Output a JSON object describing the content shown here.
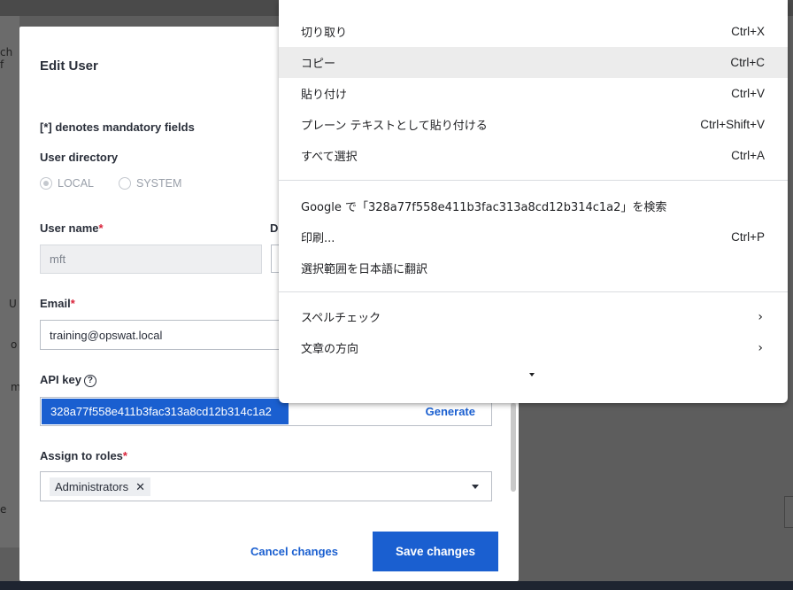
{
  "background": {
    "fragments": [
      "ch f",
      "U",
      "o",
      "m",
      "e"
    ]
  },
  "modal": {
    "title": "Edit User",
    "mandatory_note": "[*] denotes mandatory fields",
    "user_directory": {
      "label": "User directory",
      "options": [
        "LOCAL",
        "SYSTEM"
      ],
      "selected": "LOCAL"
    },
    "user_name": {
      "label": "User name",
      "required_mark": "*",
      "value": "mft"
    },
    "display_name_label_fragment": "D",
    "email": {
      "label": "Email",
      "required_mark": "*",
      "value": "training@opswat.local"
    },
    "api_key": {
      "label": "API key",
      "help_icon": "?",
      "value": "328a77f558e411b3fac313a8cd12b314c1a2",
      "generate_label": "Generate"
    },
    "roles": {
      "label": "Assign to roles",
      "required_mark": "*",
      "chip": "Administrators",
      "chip_remove": "✕"
    },
    "cancel_label": "Cancel changes",
    "save_label": "Save changes"
  },
  "context_menu": {
    "items_group1": [
      {
        "label": "切り取り",
        "shortcut": "Ctrl+X"
      },
      {
        "label": "コピー",
        "shortcut": "Ctrl+C",
        "hover": true
      },
      {
        "label": "貼り付け",
        "shortcut": "Ctrl+V"
      },
      {
        "label": "プレーン テキストとして貼り付ける",
        "shortcut": "Ctrl+Shift+V"
      },
      {
        "label": "すべて選択",
        "shortcut": "Ctrl+A"
      }
    ],
    "items_group2": [
      {
        "label": "Google で「328a77f558e411b3fac313a8cd12b314c1a2」を検索",
        "shortcut": ""
      },
      {
        "label": "印刷...",
        "shortcut": "Ctrl+P"
      },
      {
        "label": "選択範囲を日本語に翻訳",
        "shortcut": ""
      }
    ],
    "items_group3": [
      {
        "label": "スペルチェック",
        "submenu": "›"
      },
      {
        "label": "文章の方向",
        "submenu": "›"
      }
    ]
  },
  "colors": {
    "accent": "#1a5fd0",
    "required": "#d9233a",
    "overlay": "#5d5d5d"
  }
}
